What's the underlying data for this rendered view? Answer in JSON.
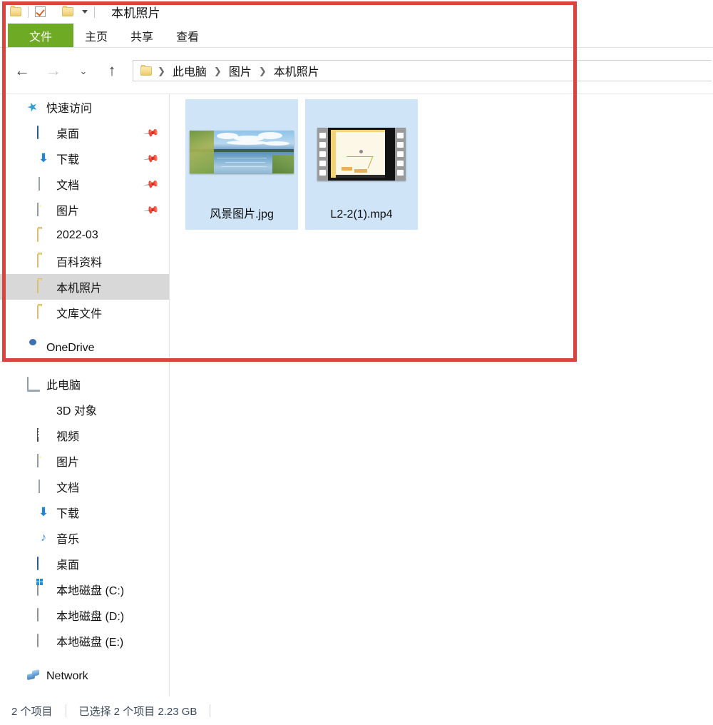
{
  "window": {
    "title": "本机照片",
    "quick_access_toolbar": [
      {
        "icon": "folder-icon",
        "name": "properties"
      },
      {
        "icon": "checkbox-checked-icon",
        "name": "toggle-selection"
      },
      {
        "icon": "folder-icon",
        "name": "new-folder"
      },
      {
        "icon": "chevron-down-icon",
        "name": "customize-quick-access"
      }
    ]
  },
  "ribbon": {
    "tabs": [
      {
        "label": "文件",
        "active": true
      },
      {
        "label": "主页",
        "active": false
      },
      {
        "label": "共享",
        "active": false
      },
      {
        "label": "查看",
        "active": false
      }
    ],
    "active_tab_color": "#6faa24"
  },
  "address_bar": {
    "back_label": "←",
    "forward_label": "→",
    "recent_label": "⌄",
    "up_label": "↑",
    "breadcrumbs": [
      "此电脑",
      "图片",
      "本机照片"
    ],
    "separator": "❯"
  },
  "nav_pane": {
    "groups": [
      {
        "header": {
          "label": "快速访问",
          "icon": "star-icon"
        },
        "items": [
          {
            "label": "桌面",
            "icon": "desktop-icon",
            "pinned": true
          },
          {
            "label": "下载",
            "icon": "download-icon",
            "pinned": true
          },
          {
            "label": "文档",
            "icon": "document-icon",
            "pinned": true
          },
          {
            "label": "图片",
            "icon": "pictures-icon",
            "pinned": true
          },
          {
            "label": "2022-03",
            "icon": "folder-icon",
            "pinned": false
          },
          {
            "label": "百科资料",
            "icon": "folder-icon",
            "pinned": false
          },
          {
            "label": "本机照片",
            "icon": "folder-icon",
            "pinned": false,
            "selected": true
          },
          {
            "label": "文库文件",
            "icon": "folder-icon",
            "pinned": false
          }
        ]
      },
      {
        "header": {
          "label": "OneDrive",
          "icon": "onedrive-icon"
        },
        "items": []
      },
      {
        "header": {
          "label": "此电脑",
          "icon": "this-pc-icon"
        },
        "items": [
          {
            "label": "3D 对象",
            "icon": "3d-objects-icon"
          },
          {
            "label": "视频",
            "icon": "videos-icon"
          },
          {
            "label": "图片",
            "icon": "pictures-icon"
          },
          {
            "label": "文档",
            "icon": "document-icon"
          },
          {
            "label": "下载",
            "icon": "download-icon"
          },
          {
            "label": "音乐",
            "icon": "music-icon"
          },
          {
            "label": "桌面",
            "icon": "desktop-icon"
          },
          {
            "label": "本地磁盘 (C:)",
            "icon": "windows-drive-icon"
          },
          {
            "label": "本地磁盘 (D:)",
            "icon": "drive-icon"
          },
          {
            "label": "本地磁盘 (E:)",
            "icon": "drive-icon"
          }
        ]
      },
      {
        "header": {
          "label": "Network",
          "icon": "network-icon"
        },
        "items": []
      }
    ],
    "pin_glyph": "📌",
    "selected_row_color": "#d8d8d8"
  },
  "files": {
    "selection_color": "#cfe4f7",
    "items": [
      {
        "name": "风景图片.jpg",
        "type": "image",
        "selected": true
      },
      {
        "name": "L2-2(1).mp4",
        "type": "video",
        "selected": true
      }
    ]
  },
  "status_bar": {
    "item_count": "2 个项目",
    "selection_info": "已选择 2 个项目  2.23 GB"
  },
  "annotation": {
    "color": "#d9443c",
    "shape": "rectangle"
  }
}
